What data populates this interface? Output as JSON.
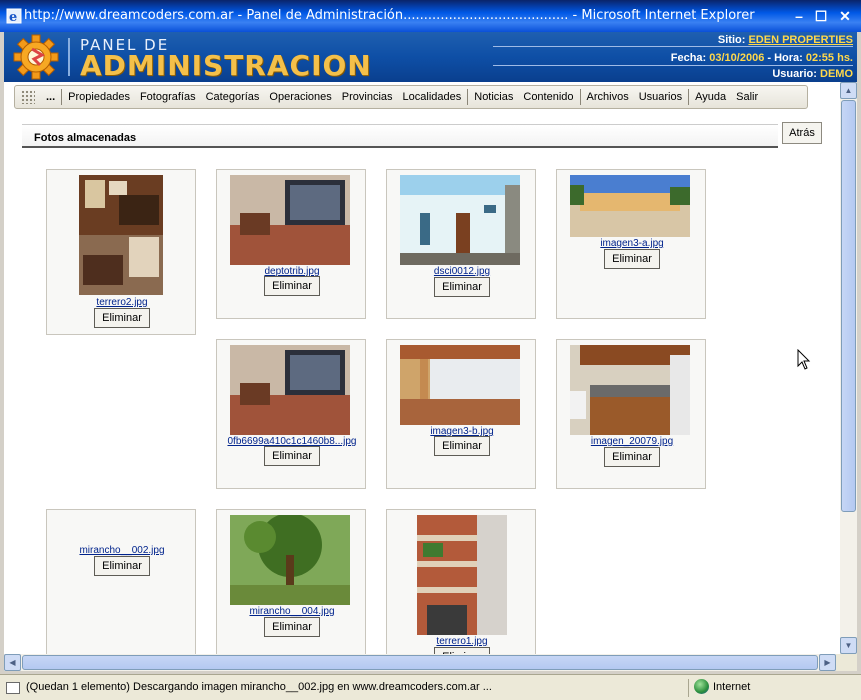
{
  "window": {
    "title": "http://www.dreamcoders.com.ar - Panel de Administración........................................ - Microsoft Internet Explorer",
    "min": "–",
    "max": "☐",
    "close": "✕"
  },
  "header": {
    "logo_top": "PANEL DE",
    "logo_main": "ADMINISTRACION",
    "sitio_label": "Sitio:",
    "sitio_value": "EDEN PROPERTIES",
    "fecha_label": "Fecha:",
    "fecha_value": "03/10/2006",
    "hora_label": "- Hora:",
    "hora_value": "02:55 hs.",
    "usuario_label": "Usuario:",
    "usuario_value": "DEMO"
  },
  "menu": {
    "items": [
      "...",
      "Propiedades",
      "Fotografías",
      "Categorías",
      "Operaciones",
      "Provincias",
      "Localidades",
      "Noticias",
      "Contenido",
      "Archivos",
      "Usuarios",
      "Ayuda",
      "Salir"
    ]
  },
  "content": {
    "section_title": "Fotos almacenadas",
    "back_label": "Atrás",
    "delete_label": "Eliminar"
  },
  "photos": [
    {
      "file": "terrero2.jpg"
    },
    {
      "file": "deptotrib.jpg"
    },
    {
      "file": "dsci0012.jpg"
    },
    {
      "file": "imagen3-a.jpg"
    },
    {
      "file": "0fb6699a410c1c1460b8...jpg"
    },
    {
      "file": "imagen3-b.jpg"
    },
    {
      "file": "imagen_20079.jpg"
    },
    {
      "file": "mirancho__002.jpg"
    },
    {
      "file": "mirancho__004.jpg"
    },
    {
      "file": "terrero1.jpg"
    }
  ],
  "status": {
    "text": "(Quedan 1 elemento) Descargando imagen mirancho__002.jpg en www.dreamcoders.com.ar ...",
    "zone": "Internet"
  },
  "colors": {
    "banner": "#0e4fa6",
    "accent": "#ffd84a",
    "link": "#00238c"
  }
}
